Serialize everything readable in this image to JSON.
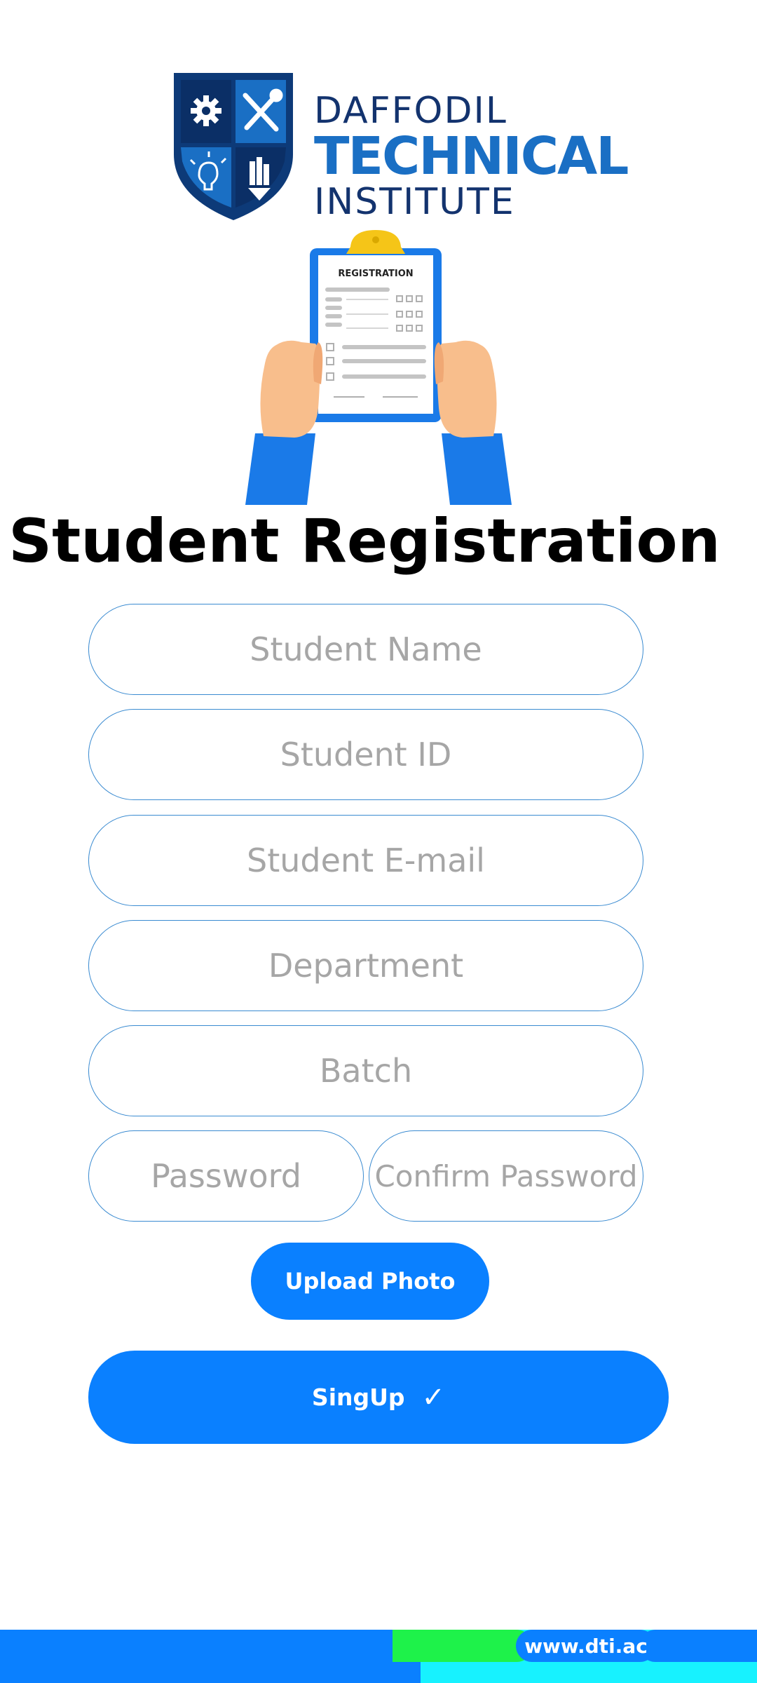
{
  "header": {
    "logo_line1": "DAFFODIL",
    "logo_line2": "TECHNICAL",
    "logo_line3": "INSTITUTE",
    "shield_icons": [
      "gear-icon",
      "tools-icon",
      "lightbulb-icon",
      "pencil-icon"
    ]
  },
  "illustration": {
    "clipboard_label": "REGISTRATION"
  },
  "page_title": "Student Registration",
  "form": {
    "student_name_placeholder": "Student Name",
    "student_id_placeholder": "Student ID",
    "student_email_placeholder": "Student E-mail",
    "department_placeholder": "Department",
    "batch_placeholder": "Batch",
    "password_placeholder": "Password",
    "confirm_password_placeholder": "Confirm Password",
    "upload_photo_label": "Upload Photo",
    "signup_label": "SingUp",
    "signup_check": "✓"
  },
  "footer": {
    "website": "www.dti.ac"
  },
  "colors": {
    "accent": "#0a80ff",
    "field_border": "#3a8bd1",
    "logo_navy": "#13336e",
    "logo_blue": "#1a6fc4",
    "footer_cyan": "#17f2ff",
    "footer_green": "#1ef24a"
  }
}
